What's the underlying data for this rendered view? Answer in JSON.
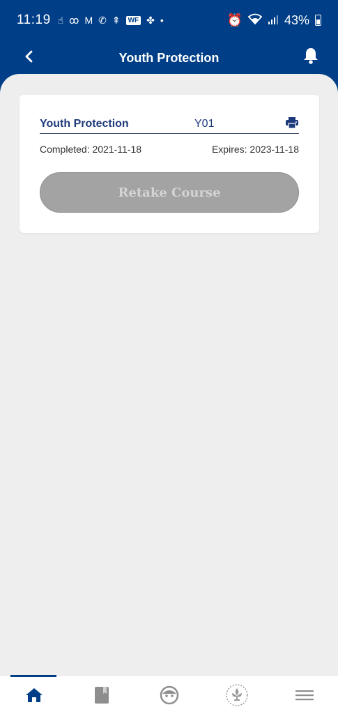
{
  "status_bar": {
    "time": "11:19",
    "battery": "43%",
    "wf_badge": "WF"
  },
  "app_bar": {
    "title": "Youth Protection"
  },
  "card": {
    "course_name": "Youth Protection",
    "course_code": "Y01",
    "completed": "Completed: 2021-11-18",
    "expires": "Expires: 2023-11-18",
    "retake_label": "Retake Course"
  },
  "bottom_nav": {
    "items": [
      {
        "icon": "home-icon",
        "active": true
      },
      {
        "icon": "book-icon",
        "active": false
      },
      {
        "icon": "face-icon",
        "active": false
      },
      {
        "icon": "fleur-de-lis-icon",
        "active": false
      },
      {
        "icon": "menu-icon",
        "active": false
      }
    ]
  },
  "colors": {
    "brand": "#003f87",
    "title_text": "#1d3a7a",
    "disabled_button": "#a3a3a3",
    "background": "#eeeeee"
  }
}
